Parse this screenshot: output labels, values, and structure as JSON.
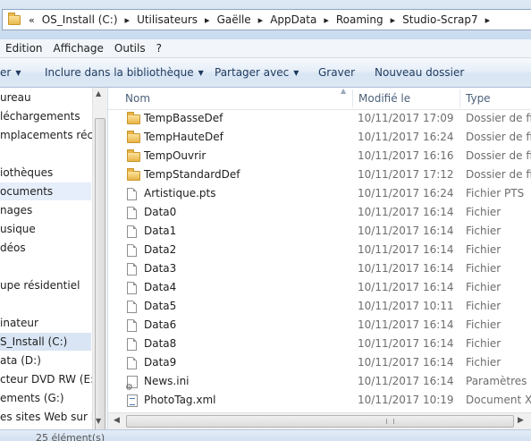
{
  "address_bar": {
    "overflow": "«",
    "crumbs": [
      "OS_Install (C:)",
      "Utilisateurs",
      "Gaëlle",
      "AppData",
      "Roaming",
      "Studio-Scrap7"
    ]
  },
  "menu": [
    "Edition",
    "Affichage",
    "Outils",
    "?"
  ],
  "toolbar": {
    "organize_label": "er",
    "include_label": "Inclure dans la bibliothèque",
    "share_label": "Partager avec",
    "burn_label": "Graver",
    "new_folder_label": "Nouveau dossier"
  },
  "nav": {
    "items": [
      "ureau",
      "léchargements",
      "mplacements récent",
      "",
      "iothèques",
      "ocuments",
      "nages",
      "usique",
      "déos",
      "",
      "upe résidentiel",
      "",
      "inateur",
      "S_Install (C:)",
      "ata (D:)",
      "cteur DVD RW (E:) M",
      "ements (G:)",
      "es sites Web sur MS"
    ]
  },
  "columns": {
    "name": "Nom",
    "modified": "Modifié le",
    "type": "Type"
  },
  "files": [
    {
      "icon": "folder-icon",
      "name": "TempBasseDef",
      "date": "10/11/2017 17:09",
      "type": "Dossier de fich"
    },
    {
      "icon": "folder-icon",
      "name": "TempHauteDef",
      "date": "10/11/2017 16:24",
      "type": "Dossier de fich"
    },
    {
      "icon": "folder-icon",
      "name": "TempOuvrir",
      "date": "10/11/2017 16:16",
      "type": "Dossier de fich"
    },
    {
      "icon": "folder-icon",
      "name": "TempStandardDef",
      "date": "10/11/2017 17:12",
      "type": "Dossier de fich"
    },
    {
      "icon": "file-icon",
      "name": "Artistique.pts",
      "date": "10/11/2017 16:24",
      "type": "Fichier PTS"
    },
    {
      "icon": "file-icon",
      "name": "Data0",
      "date": "10/11/2017 16:14",
      "type": "Fichier"
    },
    {
      "icon": "file-icon",
      "name": "Data1",
      "date": "10/11/2017 16:14",
      "type": "Fichier"
    },
    {
      "icon": "file-icon",
      "name": "Data2",
      "date": "10/11/2017 16:14",
      "type": "Fichier"
    },
    {
      "icon": "file-icon",
      "name": "Data3",
      "date": "10/11/2017 16:14",
      "type": "Fichier"
    },
    {
      "icon": "file-icon",
      "name": "Data4",
      "date": "10/11/2017 16:14",
      "type": "Fichier"
    },
    {
      "icon": "file-icon",
      "name": "Data5",
      "date": "10/11/2017 10:11",
      "type": "Fichier"
    },
    {
      "icon": "file-icon",
      "name": "Data6",
      "date": "10/11/2017 16:14",
      "type": "Fichier"
    },
    {
      "icon": "file-icon",
      "name": "Data8",
      "date": "10/11/2017 16:14",
      "type": "Fichier"
    },
    {
      "icon": "file-icon",
      "name": "Data9",
      "date": "10/11/2017 16:14",
      "type": "Fichier"
    },
    {
      "icon": "settings-file-icon",
      "name": "News.ini",
      "date": "10/11/2017 16:14",
      "type": "Paramètres de"
    },
    {
      "icon": "xml-file-icon",
      "name": "PhotoTag.xml",
      "date": "10/11/2017 10:19",
      "type": "Document XM"
    }
  ],
  "status": {
    "text": "25 élément(s)"
  }
}
